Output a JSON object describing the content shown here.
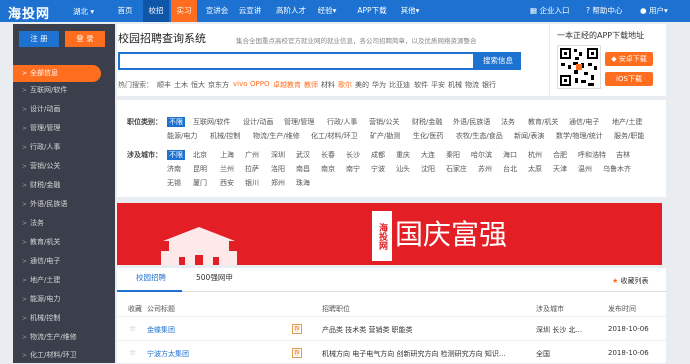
{
  "topbar": {
    "logo": "海投网",
    "city": "湖北",
    "nav": [
      "首页",
      "校招",
      "实习",
      "宣讲会",
      "云宣讲",
      "高阶人才",
      "经验",
      "APP下载",
      "其他"
    ],
    "enterprise": "企业入口",
    "help": "帮助中心",
    "user": "用户"
  },
  "sidebar": {
    "register": "注 册",
    "login": "登 录",
    "items": [
      "全部信息",
      "互联网/软件",
      "设计/动画",
      "管理/管理",
      "行政/人事",
      "营销/公关",
      "财税/金融",
      "外语/民族语",
      "法务",
      "教育/机关",
      "通信/电子",
      "地产/土建",
      "能源/电力",
      "机械/控制",
      "物流/生产/维修",
      "化工/材料/环卫"
    ]
  },
  "header": {
    "title": "校园招聘查询系统",
    "subtitle": "集合全国重点高校官方就业网的就业信息，各公司招聘简章，以及优质网络资源整合",
    "search_btn": "搜索信息",
    "hot_label": "热门搜索：",
    "hot": [
      "顺丰",
      "土木",
      "恒大",
      "京东方",
      "vivo",
      "OPPO",
      "卓越教育",
      "教师",
      "材料",
      "歌尔",
      "美的",
      "华为",
      "比亚迪",
      "软件",
      "平安",
      "机械",
      "物流",
      "银行"
    ]
  },
  "app": {
    "title": "一本正经的APP下载地址",
    "android": "安卓下载",
    "ios": "iOS下载"
  },
  "filters": {
    "category_label": "职位类别：",
    "category_all": "不限",
    "categories": [
      "互联网/软件",
      "设计/动画",
      "管理/管理",
      "行政/人事",
      "营销/公关",
      "财税/金融",
      "外语/民族语",
      "法务",
      "教育/机关",
      "通信/电子",
      "地产/土建",
      "能源/电力",
      "机械/控制",
      "物流/生产/维修",
      "化工/材料/环卫",
      "矿产/勘测",
      "生化/医药",
      "农牧/生态/食品",
      "新闻/表演",
      "数学/物理/统计",
      "服务/职能"
    ],
    "city_label": "涉及城市：",
    "city_all": "不限",
    "cities": [
      "北京",
      "上海",
      "广州",
      "深圳",
      "武汉",
      "长春",
      "长沙",
      "成都",
      "重庆",
      "大连",
      "秦阳",
      "哈尔滨",
      "海口",
      "杭州",
      "合肥",
      "呼和浩特",
      "吉林",
      "济南",
      "昆明",
      "兰州",
      "拉萨",
      "洛阳",
      "南昌",
      "南京",
      "南宁",
      "宁波",
      "汕头",
      "沈阳",
      "石家庄",
      "苏州",
      "台北",
      "太原",
      "天津",
      "温州",
      "乌鲁木齐",
      "无锡",
      "厦门",
      "西安",
      "银川",
      "郑州",
      "珠海"
    ]
  },
  "banner": {
    "stamp": "海投网",
    "text": "国庆富强"
  },
  "list": {
    "tab1": "校园招聘",
    "tab2": "500强网申",
    "fav_list": "收藏列表",
    "headers": [
      "收藏",
      "公司标题",
      "招聘职位",
      "涉及城市",
      "发布时间"
    ],
    "rows": [
      {
        "company": "金蝶集团",
        "positions": "产品类   技术类   营销类   职能类",
        "city": "深圳  长沙  北...",
        "date": "2018-10-06"
      },
      {
        "company": "宁波方太集团",
        "positions": "机械方向   电子电气方向   创新研究方向   检测研究方向   知识...",
        "city": "全国",
        "date": "2018-10-06"
      }
    ]
  }
}
